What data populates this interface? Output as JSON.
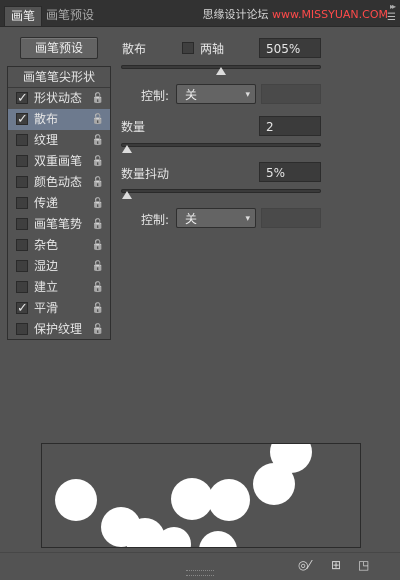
{
  "tabs": [
    {
      "label": "画笔"
    },
    {
      "label": "画笔预设"
    }
  ],
  "watermark": {
    "part1": "思缘设计论坛",
    "part2": " www.MISSYUAN.COM"
  },
  "preset_button": "画笔预设",
  "list": {
    "header": "画笔笔尖形状",
    "items": [
      {
        "label": "形状动态",
        "checked": true
      },
      {
        "label": "散布",
        "checked": true
      },
      {
        "label": "纹理",
        "checked": false
      },
      {
        "label": "双重画笔",
        "checked": false
      },
      {
        "label": "颜色动态",
        "checked": false
      },
      {
        "label": "传递",
        "checked": false
      },
      {
        "label": "画笔笔势",
        "checked": false
      },
      {
        "label": "杂色",
        "checked": false
      },
      {
        "label": "湿边",
        "checked": false
      },
      {
        "label": "建立",
        "checked": false
      },
      {
        "label": "平滑",
        "checked": true
      },
      {
        "label": "保护纹理",
        "checked": false
      }
    ]
  },
  "scatter": {
    "label": "散布",
    "both_axes_label": "两轴",
    "both_axes_checked": false,
    "value": "505%",
    "slider_fraction": 0.5,
    "control_label": "控制:",
    "control_value": "关"
  },
  "count": {
    "label": "数量",
    "value": "2",
    "slider_fraction": 0.03
  },
  "count_jitter": {
    "label": "数量抖动",
    "value": "5%",
    "slider_fraction": 0.03,
    "control_label": "控制:",
    "control_value": "关"
  },
  "icons": {
    "lock": "lock-icon",
    "dropdown": "chevron-down-icon",
    "brush_toggle": "brush-toggle-icon",
    "grid": "grid-icon",
    "new_preset": "new-preset-icon"
  }
}
